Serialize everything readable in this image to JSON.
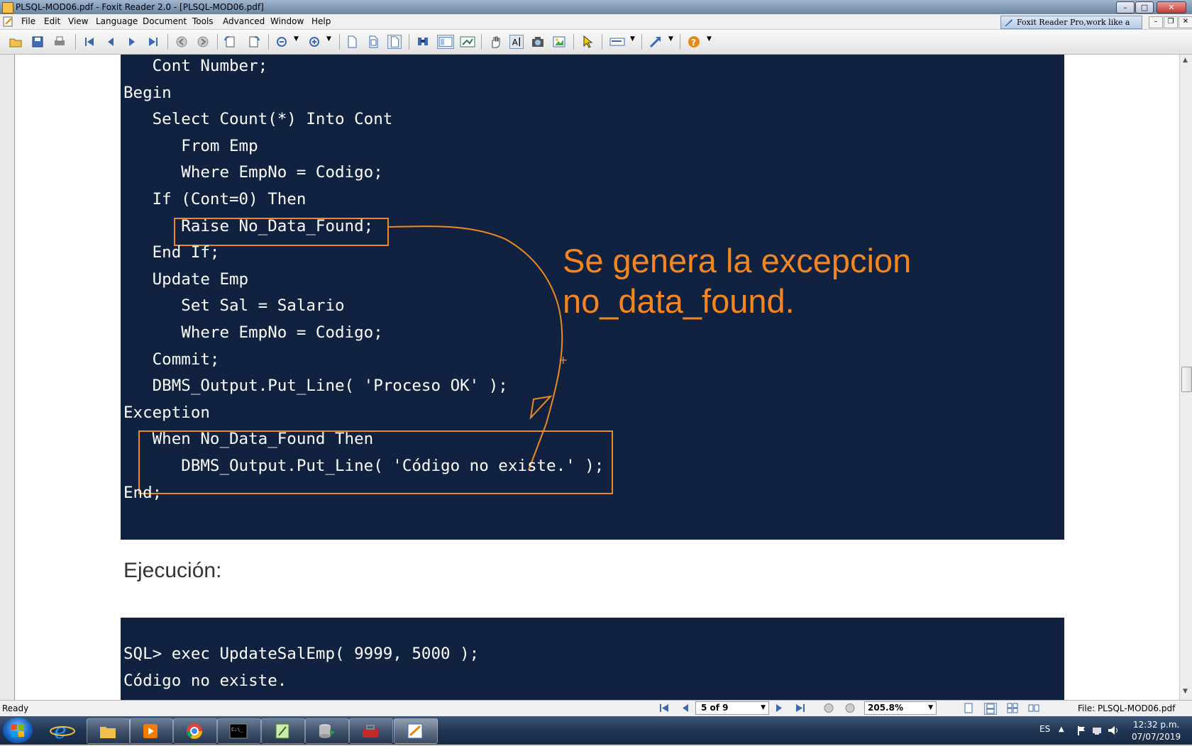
{
  "window": {
    "title": "PLSQL-MOD06.pdf - Foxit Reader 2.0 - [PLSQL-MOD06.pdf]",
    "min_label": "–",
    "max_label": "□",
    "close_label": "✕"
  },
  "menu": {
    "items": [
      "File",
      "Edit",
      "View",
      "Language",
      "Document",
      "Tools",
      "Advanced",
      "Window",
      "Help"
    ],
    "promo": "Foxit Reader Pro,work like a pro!",
    "mdi_min": "–",
    "mdi_restore": "❐",
    "mdi_close": "✕"
  },
  "toolbar": {
    "icons": [
      "open-icon",
      "save-icon",
      "print-icon",
      "first-page-icon",
      "prev-page-icon",
      "next-page-icon",
      "last-page-icon",
      "back-icon",
      "forward-icon",
      "rotate-left-icon",
      "rotate-right-icon",
      "zoom-out-icon",
      "zoom-in-icon",
      "actual-size-icon",
      "fit-page-icon",
      "fit-width-icon",
      "find-icon",
      "bookmark-panel-icon",
      "snapshot-icon",
      "hand-tool-icon",
      "text-select-icon",
      "camera-icon",
      "image-icon",
      "select-arrow-icon",
      "typewriter-icon",
      "link-tool-icon",
      "help-icon"
    ]
  },
  "document": {
    "code_lines": [
      "   Cont Number;",
      "Begin",
      "   Select Count(*) Into Cont",
      "      From Emp",
      "      Where EmpNo = Codigo;",
      "   If (Cont=0) Then",
      "      Raise No_Data_Found;",
      "   End If;",
      "   Update Emp",
      "      Set Sal = Salario",
      "      Where EmpNo = Codigo;",
      "   Commit;",
      "   DBMS_Output.Put_Line( 'Proceso OK' );",
      "Exception",
      "   When No_Data_Found Then",
      "      DBMS_Output.Put_Line( 'Código no existe.' );",
      "End;"
    ],
    "annotation_line1": "Se genera la excepcion",
    "annotation_line2": "no_data_found.",
    "heading": "Ejecución:",
    "exec_lines": [
      "SQL> exec UpdateSalEmp( 9999, 5000 );",
      "Código no existe."
    ],
    "annotation_color": "#ee8a1f",
    "code_background": "#10223f"
  },
  "status": {
    "ready": "Ready",
    "page": "5 of 9",
    "zoom": "205.8%",
    "file": "File: PLSQL-MOD06.pdf"
  },
  "taskbar": {
    "apps": [
      "internet-explorer-icon",
      "file-explorer-icon",
      "media-player-icon",
      "chrome-icon",
      "command-prompt-icon",
      "editor-icon",
      "database-icon",
      "toolbox-icon",
      "foxit-reader-icon"
    ],
    "lang": "ES",
    "time": "12:32 p.m.",
    "date": "07/07/2019"
  }
}
